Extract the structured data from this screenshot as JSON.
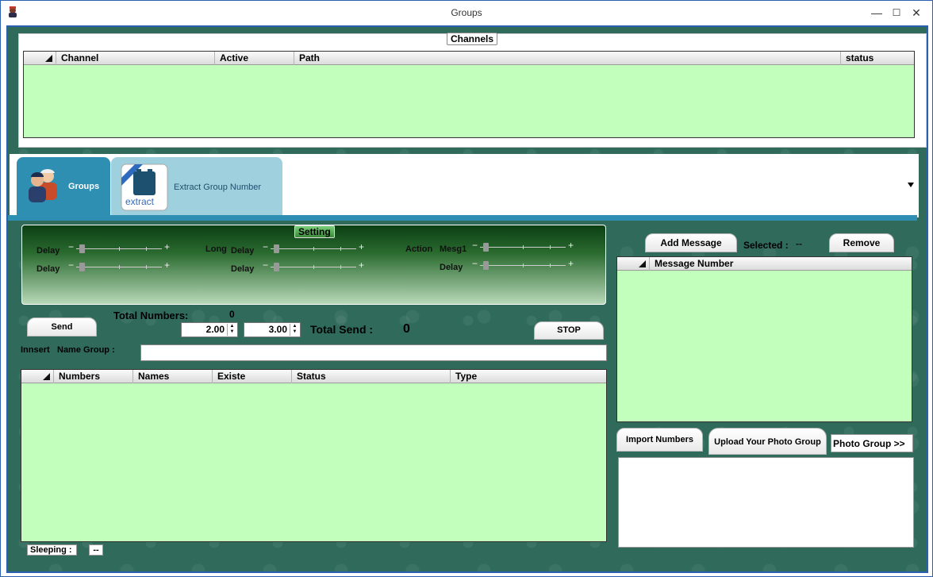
{
  "window": {
    "title": "Groups",
    "minimize": "—",
    "maximize": "☐",
    "close": "✕"
  },
  "channels": {
    "legend": "Channels",
    "columns": [
      "Channel",
      "Active",
      "Path",
      "status"
    ]
  },
  "tabs": [
    {
      "label": "Groups",
      "icon": "users-icon"
    },
    {
      "label": "Extract Group Number",
      "icon": "extract-icon",
      "icon_text": "extract"
    }
  ],
  "setting": {
    "legend": "Setting",
    "labels": {
      "delay1": "Delay",
      "delay2": "Delay",
      "long": "Long",
      "long_delay1": "Delay",
      "long_delay2": "Delay",
      "action": "Action",
      "mesg1": "Mesg1",
      "action_delay": "Delay"
    }
  },
  "controls": {
    "send": "Send",
    "stop": "STOP",
    "total_numbers_label": "Total Numbers:",
    "total_numbers_value": "0",
    "spin1": "2.00",
    "spin2": "3.00",
    "total_send_label": "Total  Send :",
    "total_send_value": "0",
    "insert_label": "Innsert",
    "name_group_label": "Name Group :",
    "name_group_value": ""
  },
  "numbers_table": {
    "columns": [
      "Numbers",
      "Names",
      "Existe",
      "Status",
      "Type"
    ]
  },
  "sleeping": {
    "label": "Sleeping :",
    "value": "--"
  },
  "messages": {
    "add": "Add Message",
    "selected_label": "Selected :",
    "selected_value": "--",
    "remove": "Remove",
    "column": "Message Number"
  },
  "photo": {
    "import": "Import Numbers",
    "upload": "Upload Your Photo Group",
    "photo_group": "Photo Group >>"
  },
  "colors": {
    "grid_bg": "#c2ffbd",
    "tab_active": "#2f8fb3",
    "tab_inactive": "#9fd0dd",
    "bg": "#2f6a5b"
  }
}
